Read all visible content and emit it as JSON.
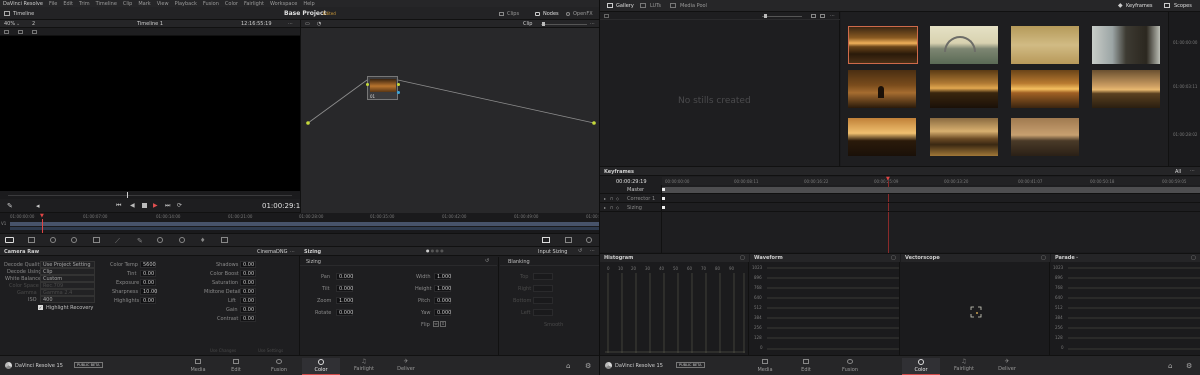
{
  "left": {
    "menubar": [
      "DaVinci Resolve",
      "File",
      "Edit",
      "Trim",
      "Timeline",
      "Clip",
      "Mark",
      "View",
      "Playback",
      "Fusion",
      "Color",
      "Fairlight",
      "Workspace",
      "Help"
    ],
    "toolbar": {
      "timeline_tab": "Timeline",
      "project": "Base Project",
      "edited": "Edited",
      "clips": "Clips",
      "nodes": "Nodes",
      "openfx": "OpenFX"
    },
    "viewer_bar": {
      "zoom": "40%",
      "count": "2",
      "timeline_name": "Timeline 1",
      "timecode": "12:16:55:19",
      "clip": "Clip"
    },
    "node": {
      "label": "01"
    },
    "transport": {
      "timecode": "01:00:29:19"
    },
    "ruler": [
      "01:00:00:00",
      "01:00:07:00",
      "01:00:14:00",
      "01:00:21:00",
      "01:00:28:00",
      "01:00:35:00",
      "01:00:42:00",
      "01:00:49:00",
      "01:00:56:00"
    ],
    "camera_raw": {
      "title": "Camera Raw",
      "format": "CinemaDNG",
      "rows": [
        {
          "label": "Decode Quality",
          "value": "Use Project Setting"
        },
        {
          "label": "Decode Using",
          "value": "Clip"
        },
        {
          "label": "White Balance",
          "value": "Custom"
        },
        {
          "label": "Color Space",
          "value": "Rec.709"
        },
        {
          "label": "Gamma",
          "value": "Gamma 2.4"
        },
        {
          "label": "ISO",
          "value": "400"
        }
      ],
      "highlight": "Highlight Recovery",
      "mid": [
        {
          "label": "Color Temp",
          "value": "5600"
        },
        {
          "label": "Tint",
          "value": "0.00"
        },
        {
          "label": "Exposure",
          "value": "0.00"
        },
        {
          "label": "Sharpness",
          "value": "10.00"
        },
        {
          "label": "Highlights",
          "value": "0.00"
        }
      ],
      "right": [
        {
          "label": "Shadows",
          "value": "0.00"
        },
        {
          "label": "Color Boost",
          "value": "0.00"
        },
        {
          "label": "Saturation",
          "value": "0.00"
        },
        {
          "label": "Midtone Detail",
          "value": "0.00"
        },
        {
          "label": "Lift",
          "value": "0.00"
        },
        {
          "label": "Gain",
          "value": "0.00"
        },
        {
          "label": "Contrast",
          "value": "0.00"
        }
      ],
      "use_changes": "Use Changes",
      "use_settings": "Use Settings"
    },
    "sizing": {
      "title": "Sizing",
      "mode": "Input Sizing",
      "sub": "Sizing",
      "left": [
        {
          "label": "Pan",
          "value": "0.000"
        },
        {
          "label": "Tilt",
          "value": "0.000"
        },
        {
          "label": "Zoom",
          "value": "1.000"
        },
        {
          "label": "Rotate",
          "value": "0.000"
        }
      ],
      "right": [
        {
          "label": "Width",
          "value": "1.000"
        },
        {
          "label": "Height",
          "value": "1.000"
        },
        {
          "label": "Pitch",
          "value": "0.000"
        },
        {
          "label": "Yaw",
          "value": "0.000"
        }
      ],
      "flip": "Flip",
      "blanking": {
        "title": "Blanking",
        "rows": [
          "Top",
          "Right",
          "Bottom",
          "Left"
        ],
        "smooth": "Smooth"
      }
    },
    "bottom_nav": {
      "brand": "DaVinci Resolve 15",
      "badge": "PUBLIC BETA",
      "tabs": [
        "Media",
        "Edit",
        "Fusion",
        "Color",
        "Fairlight",
        "Deliver"
      ],
      "active": "Color"
    }
  },
  "right": {
    "toolbar": {
      "gallery": "Gallery",
      "luts": "LUTs",
      "media_pool": "Media Pool",
      "keyframes": "Keyframes",
      "scopes": "Scopes"
    },
    "no_stills": "No stills created",
    "thumbs_right_tc": [
      "01:00:00:00",
      "01:00:03:11",
      "01:00:28:02"
    ],
    "keyframes": {
      "title": "Keyframes",
      "all": "All",
      "timecode": "00:00:29:19",
      "ticks": [
        "00:00:00:00",
        "00:00:08:11",
        "00:00:16:22",
        "00:00:25:09",
        "00:00:33:20",
        "00:00:41:07",
        "00:00:50:18",
        "00:00:59:05"
      ],
      "tracks": [
        "Master",
        "Corrector 1",
        "Sizing"
      ]
    },
    "scopes": {
      "histogram": {
        "title": "Histogram",
        "ticks": [
          "0",
          "10",
          "20",
          "30",
          "40",
          "50",
          "60",
          "70",
          "80",
          "90"
        ]
      },
      "waveform": {
        "title": "Waveform",
        "ticks": [
          "1023",
          "896",
          "768",
          "640",
          "512",
          "384",
          "256",
          "128",
          "0"
        ]
      },
      "vectorscope": {
        "title": "Vectorscope"
      },
      "parade": {
        "title": "Parade",
        "ticks": [
          "1023",
          "896",
          "768",
          "640",
          "512",
          "384",
          "256",
          "128",
          "0"
        ]
      }
    },
    "bottom_nav": {
      "brand": "DaVinci Resolve 15",
      "badge": "PUBLIC BETA",
      "tabs": [
        "Media",
        "Edit",
        "Fusion",
        "Color",
        "Fairlight",
        "Deliver"
      ],
      "active": "Color"
    }
  }
}
